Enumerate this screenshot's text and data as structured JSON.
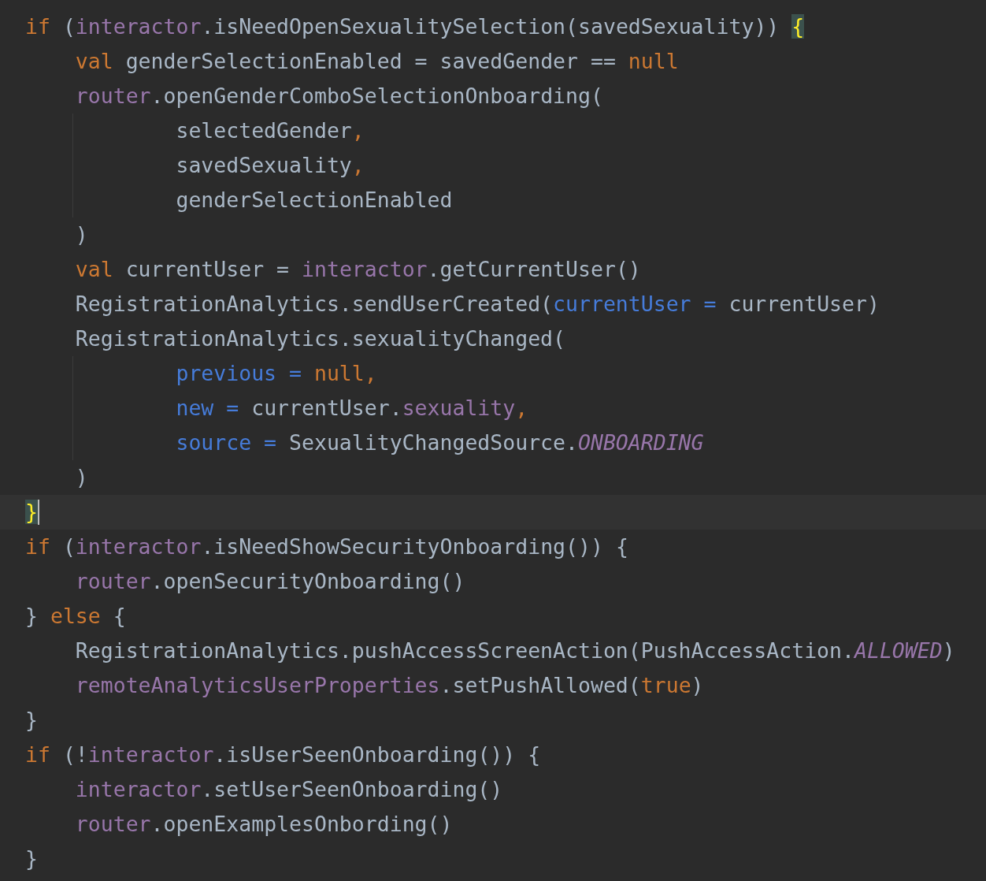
{
  "editor": {
    "lines": [
      {
        "current": false,
        "tokens": [
          {
            "text": "if",
            "kind": "keyword"
          },
          {
            "text": " (",
            "kind": "plain"
          },
          {
            "text": "interactor",
            "kind": "property"
          },
          {
            "text": ".isNeedOpenSexualitySelection(savedSexuality)) ",
            "kind": "plain"
          },
          {
            "text": "{",
            "kind": "brace_match"
          }
        ]
      },
      {
        "current": false,
        "tokens": [
          {
            "text": "    val",
            "kind": "keyword"
          },
          {
            "text": " genderSelectionEnabled = savedGender == ",
            "kind": "plain"
          },
          {
            "text": "null",
            "kind": "keyword"
          }
        ]
      },
      {
        "current": false,
        "tokens": [
          {
            "text": "    router",
            "kind": "property"
          },
          {
            "text": ".openGenderComboSelectionOnboarding(",
            "kind": "plain"
          }
        ]
      },
      {
        "current": false,
        "tokens": [
          {
            "text": "            selectedGender",
            "kind": "plain"
          },
          {
            "text": ",",
            "kind": "keyword"
          }
        ]
      },
      {
        "current": false,
        "tokens": [
          {
            "text": "            savedSexuality",
            "kind": "plain"
          },
          {
            "text": ",",
            "kind": "keyword"
          }
        ]
      },
      {
        "current": false,
        "tokens": [
          {
            "text": "            genderSelectionEnabled",
            "kind": "plain"
          }
        ]
      },
      {
        "current": false,
        "tokens": [
          {
            "text": "    )",
            "kind": "plain"
          }
        ]
      },
      {
        "current": false,
        "tokens": [
          {
            "text": "    val",
            "kind": "keyword"
          },
          {
            "text": " currentUser = ",
            "kind": "plain"
          },
          {
            "text": "interactor",
            "kind": "property"
          },
          {
            "text": ".getCurrentUser()",
            "kind": "plain"
          }
        ]
      },
      {
        "current": false,
        "tokens": [
          {
            "text": "    RegistrationAnalytics.sendUserCreated(",
            "kind": "plain"
          },
          {
            "text": "currentUser = ",
            "kind": "param"
          },
          {
            "text": "currentUser)",
            "kind": "plain"
          }
        ]
      },
      {
        "current": false,
        "tokens": [
          {
            "text": "    RegistrationAnalytics.sexualityChanged(",
            "kind": "plain"
          }
        ]
      },
      {
        "current": false,
        "tokens": [
          {
            "text": "            previous = ",
            "kind": "param"
          },
          {
            "text": "null,",
            "kind": "keyword"
          }
        ]
      },
      {
        "current": false,
        "tokens": [
          {
            "text": "            new = ",
            "kind": "param"
          },
          {
            "text": "currentUser.",
            "kind": "plain"
          },
          {
            "text": "sexuality",
            "kind": "property"
          },
          {
            "text": ",",
            "kind": "keyword"
          }
        ]
      },
      {
        "current": false,
        "tokens": [
          {
            "text": "            source = ",
            "kind": "param"
          },
          {
            "text": "SexualityChangedSource.",
            "kind": "plain"
          },
          {
            "text": "ONBOARDING",
            "kind": "constant"
          }
        ]
      },
      {
        "current": false,
        "tokens": [
          {
            "text": "    )",
            "kind": "plain"
          }
        ]
      },
      {
        "current": true,
        "tokens": [
          {
            "text": "}",
            "kind": "brace_match"
          }
        ]
      },
      {
        "current": false,
        "tokens": [
          {
            "text": "if",
            "kind": "keyword"
          },
          {
            "text": " (",
            "kind": "plain"
          },
          {
            "text": "interactor",
            "kind": "property"
          },
          {
            "text": ".isNeedShowSecurityOnboarding()) {",
            "kind": "plain"
          }
        ]
      },
      {
        "current": false,
        "tokens": [
          {
            "text": "    router",
            "kind": "property"
          },
          {
            "text": ".openSecurityOnboarding()",
            "kind": "plain"
          }
        ]
      },
      {
        "current": false,
        "tokens": [
          {
            "text": "} ",
            "kind": "plain"
          },
          {
            "text": "else",
            "kind": "keyword"
          },
          {
            "text": " {",
            "kind": "plain"
          }
        ]
      },
      {
        "current": false,
        "tokens": [
          {
            "text": "    RegistrationAnalytics.pushAccessScreenAction(PushAccessAction.",
            "kind": "plain"
          },
          {
            "text": "ALLOWED",
            "kind": "constant"
          },
          {
            "text": ")",
            "kind": "plain"
          }
        ]
      },
      {
        "current": false,
        "tokens": [
          {
            "text": "    remoteAnalyticsUserProperties",
            "kind": "property"
          },
          {
            "text": ".setPushAllowed(",
            "kind": "plain"
          },
          {
            "text": "true",
            "kind": "keyword"
          },
          {
            "text": ")",
            "kind": "plain"
          }
        ]
      },
      {
        "current": false,
        "tokens": [
          {
            "text": "}",
            "kind": "plain"
          }
        ]
      },
      {
        "current": false,
        "tokens": [
          {
            "text": "if",
            "kind": "keyword"
          },
          {
            "text": " (!",
            "kind": "plain"
          },
          {
            "text": "interactor",
            "kind": "property"
          },
          {
            "text": ".isUserSeenOnboarding()) {",
            "kind": "plain"
          }
        ]
      },
      {
        "current": false,
        "tokens": [
          {
            "text": "    interactor",
            "kind": "property"
          },
          {
            "text": ".setUserSeenOnboarding()",
            "kind": "plain"
          }
        ]
      },
      {
        "current": false,
        "tokens": [
          {
            "text": "    router",
            "kind": "property"
          },
          {
            "text": ".openExamplesOnbording()",
            "kind": "plain"
          }
        ]
      },
      {
        "current": false,
        "tokens": [
          {
            "text": "}",
            "kind": "plain"
          }
        ]
      }
    ]
  }
}
